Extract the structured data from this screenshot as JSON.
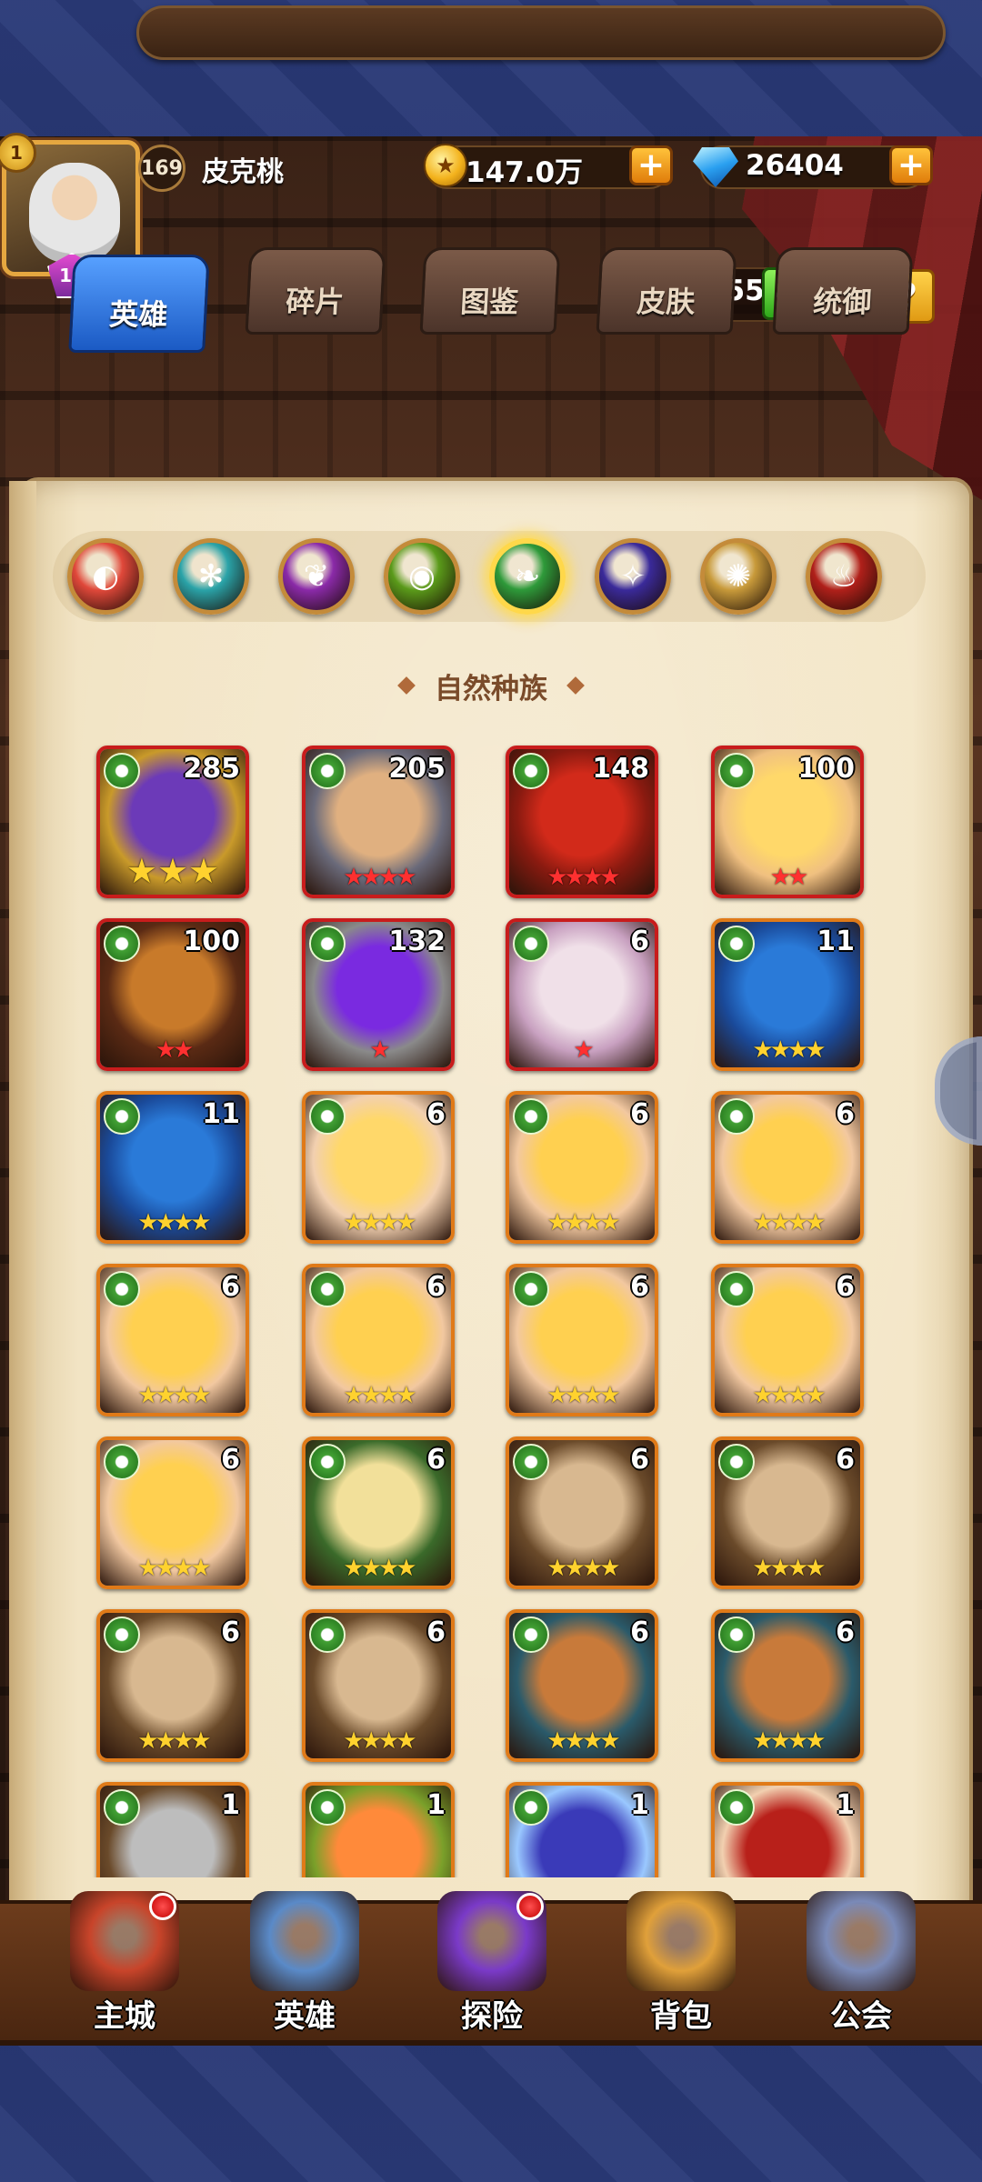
{
  "player": {
    "vip": "1",
    "avatar_level": "10",
    "level": "169",
    "name": "皮克桃"
  },
  "currency": {
    "gold": "147.0万",
    "gems": "26404",
    "plus": "+"
  },
  "capacity": {
    "value": "256/455",
    "plus": "+",
    "help": "?"
  },
  "tabs": [
    {
      "label": "英雄",
      "active": true
    },
    {
      "label": "碎片",
      "active": false
    },
    {
      "label": "图鉴",
      "active": false
    },
    {
      "label": "皮肤",
      "active": false
    },
    {
      "label": "统御",
      "active": false
    }
  ],
  "faction_filters": [
    {
      "name": "all",
      "color": "#e0483a",
      "glyph": "◐"
    },
    {
      "name": "water",
      "color": "#2aa3a8",
      "glyph": "✻"
    },
    {
      "name": "shadow",
      "color": "#8a2aa8",
      "glyph": "❦"
    },
    {
      "name": "beast",
      "color": "#5a9a1a",
      "glyph": "◉"
    },
    {
      "name": "nature",
      "color": "#2e9a3a",
      "glyph": "❧",
      "selected": true
    },
    {
      "name": "demon",
      "color": "#3a2a9a",
      "glyph": "✧"
    },
    {
      "name": "light",
      "color": "#c89a3a",
      "glyph": "✺"
    },
    {
      "name": "fire",
      "color": "#b0201a",
      "glyph": "♨"
    }
  ],
  "section_title": "自然种族",
  "heroes": [
    {
      "level": "285",
      "stars": "★★★",
      "star_color": "gold",
      "big": true,
      "c1": "#6c3ab8",
      "c2": "#c99a2a",
      "frame": "#c81c1c"
    },
    {
      "level": "205",
      "stars": "★★★★",
      "star_color": "red",
      "c1": "#e0b080",
      "c2": "#6a6a7a",
      "frame": "#c81c1c"
    },
    {
      "level": "148",
      "stars": "★★★★",
      "star_color": "red",
      "c1": "#d22a1a",
      "c2": "#8a1a10",
      "frame": "#c81c1c"
    },
    {
      "level": "100",
      "stars": "★★",
      "star_color": "red",
      "c1": "#ffd86a",
      "c2": "#f0c080",
      "frame": "#c81c1c"
    },
    {
      "level": "100",
      "stars": "★★",
      "star_color": "red",
      "c1": "#c87a2a",
      "c2": "#5a2a14",
      "frame": "#c81c1c"
    },
    {
      "level": "132",
      "stars": "★",
      "star_color": "red",
      "c1": "#7a2ae0",
      "c2": "#8a8a8a",
      "frame": "#c81c1c"
    },
    {
      "level": "6",
      "stars": "★",
      "star_color": "red",
      "c1": "#f0e0e8",
      "c2": "#c8a0c0",
      "frame": "#c81c1c"
    },
    {
      "level": "11",
      "stars": "★★★★",
      "star_color": "gold",
      "c1": "#2a7ad8",
      "c2": "#1a4a9a",
      "frame": "#e07a18"
    },
    {
      "level": "11",
      "stars": "★★★★",
      "star_color": "gold",
      "c1": "#2a7ad8",
      "c2": "#1a4a9a",
      "frame": "#e07a18"
    },
    {
      "level": "6",
      "stars": "★★★★",
      "star_color": "gold",
      "c1": "#ffd86a",
      "c2": "#f2d0b0",
      "frame": "#e07a18"
    },
    {
      "level": "6",
      "stars": "★★★★",
      "star_color": "gold",
      "c1": "#ffd050",
      "c2": "#f2c8a0",
      "frame": "#e07a18"
    },
    {
      "level": "6",
      "stars": "★★★★",
      "star_color": "gold",
      "c1": "#ffd050",
      "c2": "#f2c8a0",
      "frame": "#e07a18"
    },
    {
      "level": "6",
      "stars": "★★★★",
      "star_color": "gold",
      "c1": "#ffd050",
      "c2": "#f2c8a0",
      "frame": "#e07a18"
    },
    {
      "level": "6",
      "stars": "★★★★",
      "star_color": "gold",
      "c1": "#ffd050",
      "c2": "#f2c8a0",
      "frame": "#e07a18"
    },
    {
      "level": "6",
      "stars": "★★★★",
      "star_color": "gold",
      "c1": "#ffd050",
      "c2": "#f2c8a0",
      "frame": "#e07a18"
    },
    {
      "level": "6",
      "stars": "★★★★",
      "star_color": "gold",
      "c1": "#ffd050",
      "c2": "#f2c8a0",
      "frame": "#e07a18"
    },
    {
      "level": "6",
      "stars": "★★★★",
      "star_color": "gold",
      "c1": "#ffd050",
      "c2": "#f2c8a0",
      "frame": "#e07a18"
    },
    {
      "level": "6",
      "stars": "★★★★",
      "star_color": "gold",
      "c1": "#f2e09a",
      "c2": "#3a6a2a",
      "frame": "#e07a18"
    },
    {
      "level": "6",
      "stars": "★★★★",
      "star_color": "gold",
      "c1": "#d8b890",
      "c2": "#6a4a2a",
      "frame": "#e07a18"
    },
    {
      "level": "6",
      "stars": "★★★★",
      "star_color": "gold",
      "c1": "#d8b890",
      "c2": "#6a4a2a",
      "frame": "#e07a18"
    },
    {
      "level": "6",
      "stars": "★★★★",
      "star_color": "gold",
      "c1": "#d8b890",
      "c2": "#6a4a2a",
      "frame": "#e07a18"
    },
    {
      "level": "6",
      "stars": "★★★★",
      "star_color": "gold",
      "c1": "#d8b890",
      "c2": "#6a4a2a",
      "frame": "#e07a18"
    },
    {
      "level": "6",
      "stars": "★★★★",
      "star_color": "gold",
      "c1": "#c87a3a",
      "c2": "#2a5a6a",
      "frame": "#e07a18"
    },
    {
      "level": "6",
      "stars": "★★★★",
      "star_color": "gold",
      "c1": "#c87a3a",
      "c2": "#2a5a6a",
      "frame": "#e07a18"
    },
    {
      "level": "1",
      "stars": "",
      "star_color": "gold",
      "c1": "#bdbdbd",
      "c2": "#6a4a2a",
      "frame": "#e07a18"
    },
    {
      "level": "1",
      "stars": "",
      "star_color": "gold",
      "c1": "#ff8a3a",
      "c2": "#7aa02a",
      "frame": "#e07a18"
    },
    {
      "level": "1",
      "stars": "",
      "star_color": "gold",
      "c1": "#3a3ab8",
      "c2": "#9ac8ff",
      "frame": "#e07a18"
    },
    {
      "level": "1",
      "stars": "",
      "star_color": "gold",
      "c1": "#b8201a",
      "c2": "#f2d0b0",
      "frame": "#e07a18"
    }
  ],
  "nav": [
    {
      "label": "主城",
      "icon": "castle-icon",
      "badge": true,
      "color": "#c8442a"
    },
    {
      "label": "英雄",
      "icon": "hero-icon",
      "badge": false,
      "color": "#5a8ac8"
    },
    {
      "label": "探险",
      "icon": "portal-icon",
      "badge": true,
      "color": "#7a3ac8"
    },
    {
      "label": "背包",
      "icon": "backpack-icon",
      "badge": false,
      "color": "#e0a03a"
    },
    {
      "label": "公会",
      "icon": "guild-icon",
      "badge": false,
      "color": "#7a8ab8"
    }
  ]
}
